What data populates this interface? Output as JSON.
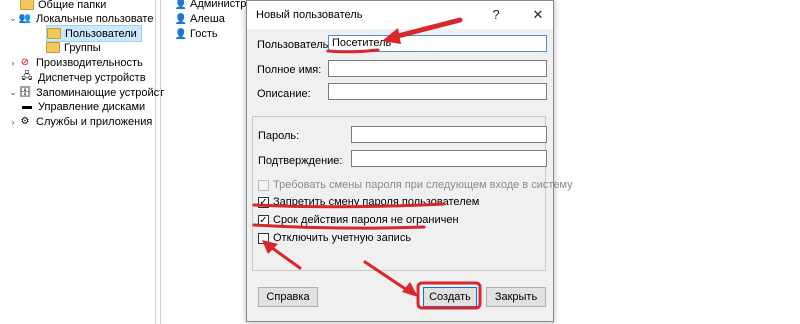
{
  "tree": {
    "items": [
      {
        "label": "Общие папки",
        "icon": "folder-share-icon"
      },
      {
        "label": "Локальные пользовате",
        "icon": "users-icon"
      },
      {
        "label": "Пользователи",
        "icon": "folder-icon"
      },
      {
        "label": "Группы",
        "icon": "folder-icon"
      },
      {
        "label": "Производительность",
        "icon": "performance-icon"
      },
      {
        "label": "Диспетчер устройств",
        "icon": "device-manager-icon"
      },
      {
        "label": "Запоминающие устройст",
        "icon": "storage-icon"
      },
      {
        "label": "Управление дисками",
        "icon": "disk-icon"
      },
      {
        "label": "Службы и приложения",
        "icon": "services-icon"
      }
    ]
  },
  "list": {
    "items": [
      {
        "label": "Администр..."
      },
      {
        "label": "Алеша"
      },
      {
        "label": "Гость"
      }
    ]
  },
  "dialog": {
    "title": "Новый пользователь",
    "help_btn": "?",
    "close_btn": "✕",
    "username_label": "Пользователь:",
    "username_value": "Посетитель",
    "fullname_label": "Полное имя:",
    "fullname_value": "",
    "description_label": "Описание:",
    "description_value": "",
    "password_label": "Пароль:",
    "confirm_label": "Подтверждение:",
    "checkboxes": [
      {
        "label": "Требовать смены пароля при следующем входе в систему",
        "checked": false,
        "disabled": true
      },
      {
        "label": "Запретить смену пароля пользователем",
        "checked": true,
        "disabled": false
      },
      {
        "label": "Срок действия пароля не ограничен",
        "checked": true,
        "disabled": false
      },
      {
        "label": "Отключить учетную запись",
        "checked": false,
        "disabled": false
      }
    ],
    "buttons": {
      "help": "Справка",
      "create": "Создать",
      "close": "Закрыть"
    }
  },
  "annotations": {
    "color": "#d9262b"
  }
}
